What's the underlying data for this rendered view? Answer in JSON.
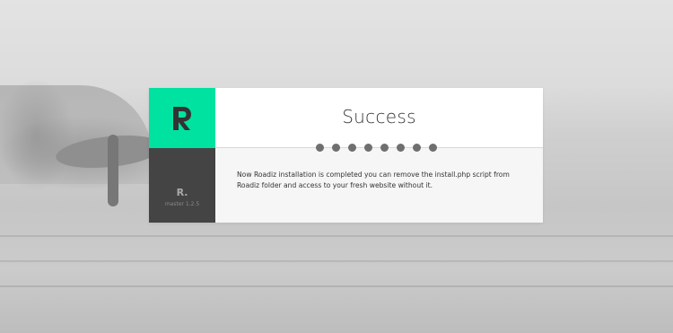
{
  "app": {
    "brand_logo": "R",
    "brand_color": "#00e3a0",
    "side_logo": "R.",
    "version": "master 1.2.5"
  },
  "main": {
    "title": "Success",
    "message": "Now Roadiz installation is completed you can remove the install.php script from Roadiz folder and access to your fresh website without it.",
    "steps_total": 8,
    "steps_completed": 8
  },
  "icons": {
    "brand": "roadiz-logo-icon"
  }
}
